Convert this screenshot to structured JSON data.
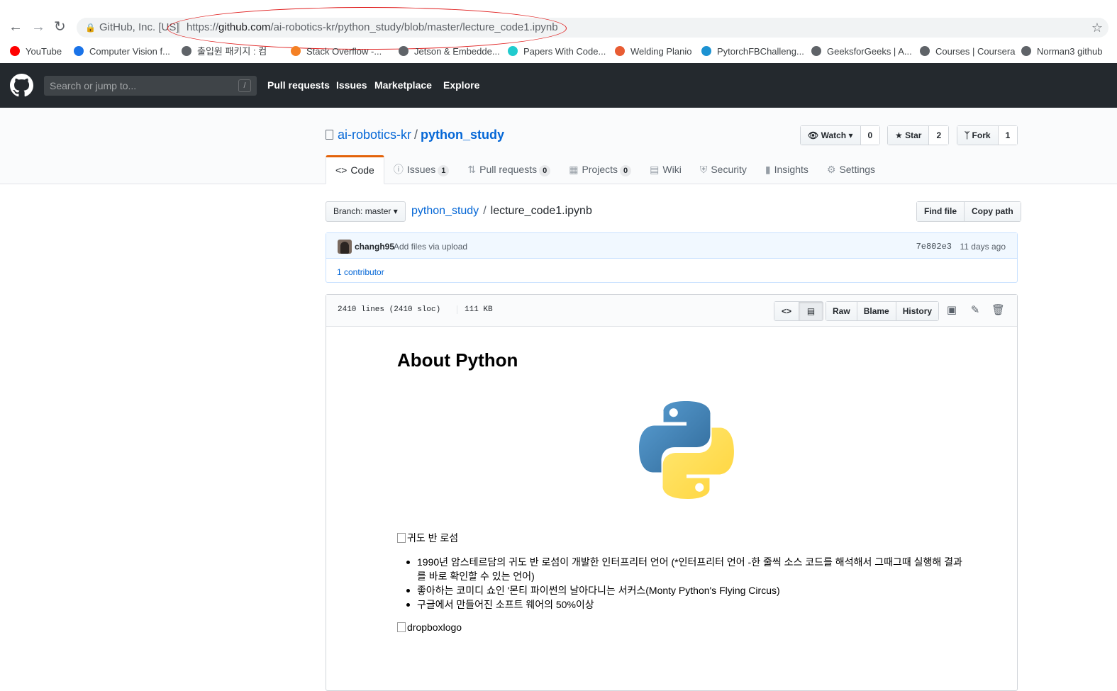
{
  "browser": {
    "site_label": "GitHub, Inc. [US]",
    "url_prefix": "https://",
    "url_host": "github.com",
    "url_path": "/ai-robotics-kr/python_study/blob/master/lecture_code1.ipynb",
    "bookmarks": [
      {
        "label": "YouTube",
        "color": "#ff0000"
      },
      {
        "label": "Computer Vision f...",
        "color": "#1a73e8"
      },
      {
        "label": "출입원 패키지 : 컴",
        "color": "#5f6368"
      },
      {
        "label": "Stack Overflow -...",
        "color": "#f48024"
      },
      {
        "label": "Jetson & Embedde...",
        "color": "#5f6368"
      },
      {
        "label": "Papers With Code...",
        "color": "#21cbce"
      },
      {
        "label": "Welding Planio",
        "color": "#e85c33"
      },
      {
        "label": "PytorchFBChalleng...",
        "color": "#1c92d2"
      },
      {
        "label": "GeeksforGeeks | A...",
        "color": "#5f6368"
      },
      {
        "label": "Courses | Coursera",
        "color": "#5f6368"
      },
      {
        "label": "Norman3 github",
        "color": "#5f6368"
      }
    ]
  },
  "header": {
    "search_placeholder": "Search or jump to...",
    "search_key": "/",
    "nav": [
      "Pull requests",
      "Issues",
      "Marketplace",
      "Explore"
    ]
  },
  "repo": {
    "owner": "ai-robotics-kr",
    "name": "python_study",
    "watch_label": "Watch",
    "watch_count": "0",
    "star_label": "Star",
    "star_count": "2",
    "fork_label": "Fork",
    "fork_count": "1",
    "tabs": [
      {
        "label": "Code",
        "icon": "code-icon"
      },
      {
        "label": "Issues",
        "count": "1",
        "icon": "issue-icon"
      },
      {
        "label": "Pull requests",
        "count": "0",
        "icon": "pr-icon"
      },
      {
        "label": "Projects",
        "count": "0",
        "icon": "project-icon"
      },
      {
        "label": "Wiki",
        "icon": "book-icon"
      },
      {
        "label": "Security",
        "icon": "shield-icon"
      },
      {
        "label": "Insights",
        "icon": "graph-icon"
      },
      {
        "label": "Settings",
        "icon": "gear-icon"
      }
    ]
  },
  "file_nav": {
    "branch_label": "Branch: master",
    "crumb_repo": "python_study",
    "crumb_file": "lecture_code1.ipynb",
    "find_file": "Find file",
    "copy_path": "Copy path"
  },
  "commit": {
    "author": "changh95",
    "message": "Add files via upload",
    "sha": "7e802e3",
    "age": "11 days ago",
    "contributors": "1 contributor"
  },
  "file": {
    "lines": "2410 lines (2410 sloc)",
    "size": "111 KB",
    "raw": "Raw",
    "blame": "Blame",
    "history": "History"
  },
  "notebook": {
    "title": "About Python",
    "img_alt_1": "귀도 반 로섬",
    "bullets": [
      "1990년 암스테르담의 귀도 반 로섬이 개발한 인터프리터 언어 (*인터프리터 언어 -한 줄씩 소스 코드를 해석해서 그때그때 실행해 결과를 바로 확인할 수 있는 언어)",
      "좋아하는 코미디 쇼인 '몬티 파이썬의 날아다니는 서커스(Monty Python's Flying Circus)",
      "구글에서 만들어진 소프트 웨어의 50%이상"
    ],
    "img_alt_2": "dropboxlogo"
  }
}
